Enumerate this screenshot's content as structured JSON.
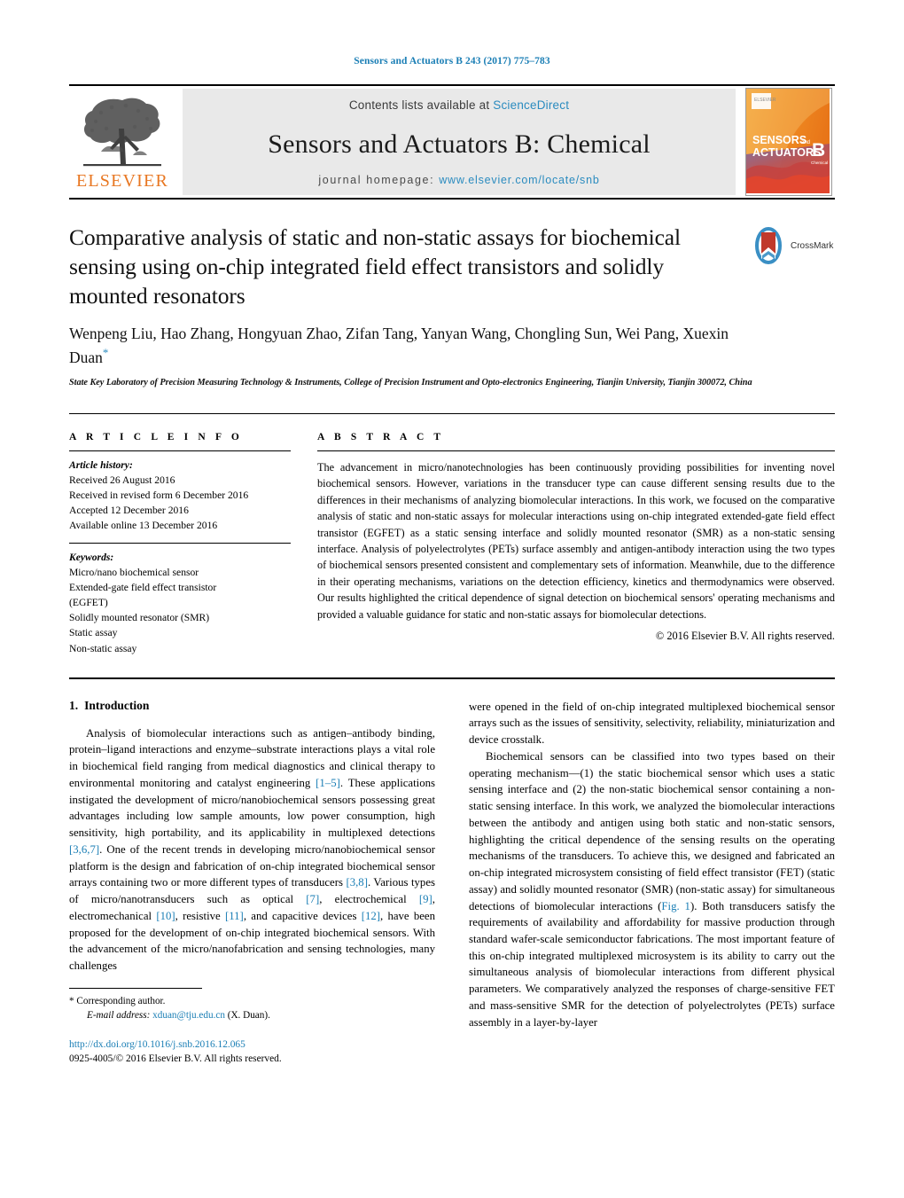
{
  "running_head": "Sensors and Actuators B 243 (2017) 775–783",
  "masthead": {
    "publisher_name": "ELSEVIER",
    "contents_prefix": "Contents lists available at ",
    "sciencedirect": "ScienceDirect",
    "journal_title": "Sensors and Actuators B: Chemical",
    "homepage_prefix": "journal homepage: ",
    "homepage_url": "www.elsevier.com/locate/snb",
    "cover_line1": "SENSORS",
    "cover_and": "and",
    "cover_line2": "ACTUATORS",
    "cover_letter": "B",
    "cover_sub": "Chemical"
  },
  "article": {
    "title": "Comparative analysis of static and non-static assays for biochemical sensing using on-chip integrated field effect transistors and solidly mounted resonators",
    "authors": "Wenpeng Liu, Hao Zhang, Hongyuan Zhao, Zifan Tang, Yanyan Wang, Chongling Sun, Wei Pang, Xuexin Duan",
    "author_star": "*",
    "affiliation": "State Key Laboratory of Precision Measuring Technology & Instruments, College of Precision Instrument and Opto-electronics Engineering, Tianjin University, Tianjin 300072, China",
    "crossmark_label": "CrossMark"
  },
  "info": {
    "heading": "A R T I C L E   I N F O",
    "history_title": "Article history:",
    "history": [
      "Received 26 August 2016",
      "Received in revised form 6 December 2016",
      "Accepted 12 December 2016",
      "Available online 13 December 2016"
    ],
    "keywords_title": "Keywords:",
    "keywords": [
      "Micro/nano biochemical sensor",
      "Extended-gate field effect transistor",
      "(EGFET)",
      "Solidly mounted resonator (SMR)",
      "Static assay",
      "Non-static assay"
    ]
  },
  "abstract": {
    "heading": "A B S T R A C T",
    "text": "The advancement in micro/nanotechnologies has been continuously providing possibilities for inventing novel biochemical sensors. However, variations in the transducer type can cause different sensing results due to the differences in their mechanisms of analyzing biomolecular interactions. In this work, we focused on the comparative analysis of static and non-static assays for molecular interactions using on-chip integrated extended-gate field effect transistor (EGFET) as a static sensing interface and solidly mounted resonator (SMR) as a non-static sensing interface. Analysis of polyelectrolytes (PETs) surface assembly and antigen-antibody interaction using the two types of biochemical sensors presented consistent and complementary sets of information. Meanwhile, due to the difference in their operating mechanisms, variations on the detection efficiency, kinetics and thermodynamics were observed. Our results highlighted the critical dependence of signal detection on biochemical sensors' operating mechanisms and provided a valuable guidance for static and non-static assays for biomolecular detections.",
    "copyright": "© 2016 Elsevier B.V. All rights reserved."
  },
  "introduction": {
    "number": "1.",
    "heading": "Introduction",
    "para1_a": "Analysis of biomolecular interactions such as antigen–antibody binding, protein–ligand interactions and enzyme–substrate interactions plays a vital role in biochemical field ranging from medical diagnostics and clinical therapy to environmental monitoring and catalyst engineering ",
    "ref1": "[1–5]",
    "para1_b": ". These applications instigated the development of micro/nanobiochemical sensors possessing great advantages including low sample amounts, low power consumption, high sensitivity, high portability, and its applicability in multiplexed detections ",
    "ref2": "[3,6,7]",
    "para1_c": ". One of the recent trends in developing micro/nanobiochemical sensor platform is the design and fabrication of on-chip integrated biochemical sensor arrays containing two or more different types of transducers ",
    "ref3": "[3,8]",
    "para1_d": ". Various types of micro/nanotransducers such as optical ",
    "ref4": "[7]",
    "para1_e": ", electrochemical ",
    "ref5": "[9]",
    "para1_f": ", electromechanical ",
    "ref6": "[10]",
    "para1_g": ", resistive ",
    "ref7": "[11]",
    "para1_h": ", and capacitive devices ",
    "ref8": "[12]",
    "para1_i": ", have been proposed for the development of on-chip integrated biochemical sensors. With the advancement of the micro/nanofabrication and sensing technologies, many challenges",
    "para1_cont": "were opened in the field of on-chip integrated multiplexed biochemical sensor arrays such as the issues of sensitivity, selectivity, reliability, miniaturization and device crosstalk.",
    "para2_a": "Biochemical sensors can be classified into two types based on their operating mechanism—(1) the static biochemical sensor which uses a static sensing interface and (2) the non-static biochemical sensor containing a non-static sensing interface. In this work, we analyzed the biomolecular interactions between the antibody and antigen using both static and non-static sensors, highlighting the critical dependence of the sensing results on the operating mechanisms of the transducers. To achieve this, we designed and fabricated an on-chip integrated microsystem consisting of field effect transistor (FET) (static assay) and solidly mounted resonator (SMR) (non-static assay) for simultaneous detections of biomolecular interactions (",
    "fig_ref": "Fig. 1",
    "para2_b": "). Both transducers satisfy the requirements of availability and affordability for massive production through standard wafer-scale semiconductor fabrications. The most important feature of this on-chip integrated multiplexed microsystem is its ability to carry out the simultaneous analysis of biomolecular interactions from different physical parameters. We comparatively analyzed the responses of charge-sensitive FET and mass-sensitive SMR for the detection of polyelectrolytes (PETs) surface assembly in a layer-by-layer"
  },
  "footer": {
    "corresponding_marker": "*",
    "corresponding_text": "Corresponding author.",
    "email_label": "E-mail address:",
    "email": "xduan@tju.edu.cn",
    "email_suffix": "(X. Duan).",
    "doi": "http://dx.doi.org/10.1016/j.snb.2016.12.065",
    "issn_line": "0925-4005/© 2016 Elsevier B.V. All rights reserved."
  },
  "colors": {
    "link": "#1a7eb5",
    "sciencedirect": "#2a8bbf",
    "elsevier_orange": "#e87722"
  }
}
